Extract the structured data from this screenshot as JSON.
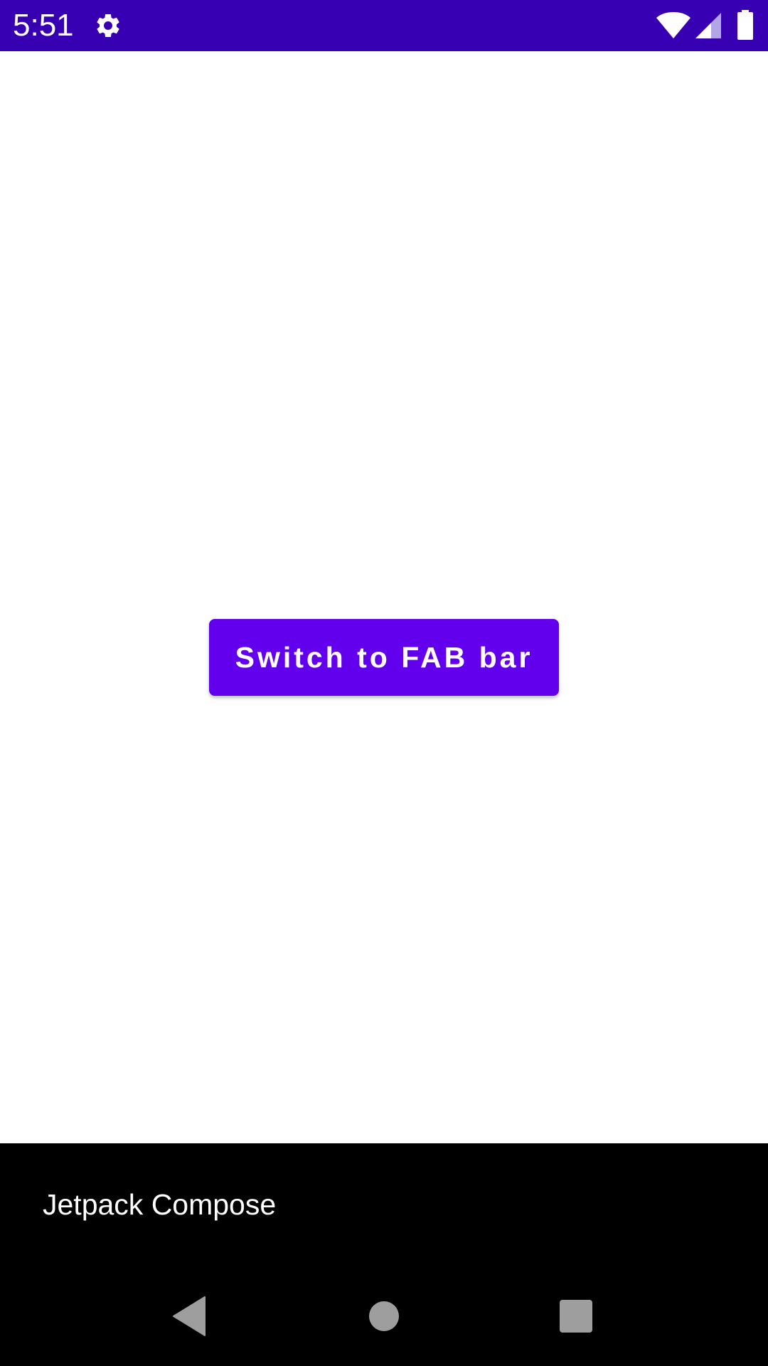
{
  "status_bar": {
    "time": "5:51",
    "icons": [
      "gear-icon",
      "wifi-icon",
      "signal-icon",
      "battery-icon"
    ],
    "background_color": "#3700b3"
  },
  "main": {
    "primary_button_label": "Switch to FAB bar",
    "button_color": "#6200ee"
  },
  "bottom_bar": {
    "title": "Jetpack Compose",
    "background_color": "#000000"
  },
  "nav_bar": {
    "icons": [
      "back-icon",
      "home-icon",
      "recents-icon"
    ]
  }
}
